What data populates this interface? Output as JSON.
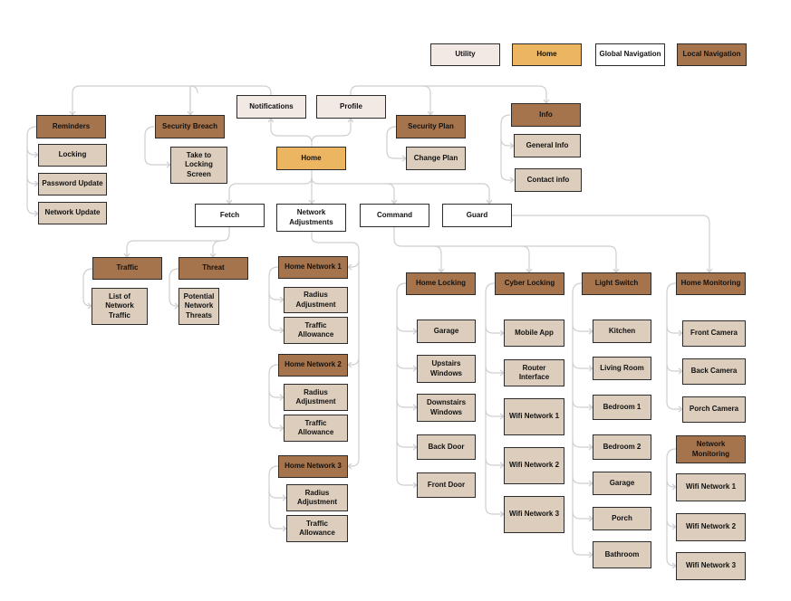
{
  "colors": {
    "utility": "#f2e8e4",
    "home": "#ecb562",
    "global": "#ffffff",
    "local": "#a6744c",
    "sub": "#dccdbc",
    "connector": "#cfcfcf"
  },
  "legend": [
    {
      "label": "Utility",
      "type": "utility"
    },
    {
      "label": "Home",
      "type": "home"
    },
    {
      "label": "Global Navigation",
      "type": "global"
    },
    {
      "label": "Local Navigation",
      "type": "local"
    }
  ],
  "nodes": {
    "notifications": {
      "label": "Notifications",
      "type": "utility"
    },
    "profile": {
      "label": "Profile",
      "type": "utility"
    },
    "home": {
      "label": "Home",
      "type": "home"
    },
    "reminders": {
      "label": "Reminders",
      "type": "local"
    },
    "locking": {
      "label": "Locking",
      "type": "sub"
    },
    "password_update": {
      "label": "Password Update",
      "type": "sub"
    },
    "network_update": {
      "label": "Network Update",
      "type": "sub"
    },
    "security_breach": {
      "label": "Security Breach",
      "type": "local"
    },
    "take_to_locking": {
      "label": "Take to Locking Screen",
      "type": "sub"
    },
    "security_plan": {
      "label": "Security Plan",
      "type": "local"
    },
    "change_plan": {
      "label": "Change Plan",
      "type": "sub"
    },
    "info": {
      "label": "Info",
      "type": "local"
    },
    "general_info": {
      "label": "General Info",
      "type": "sub"
    },
    "contact_info": {
      "label": "Contact info",
      "type": "sub"
    },
    "fetch": {
      "label": "Fetch",
      "type": "global"
    },
    "network_adjustments": {
      "label": "Network Adjustments",
      "type": "global"
    },
    "command": {
      "label": "Command",
      "type": "global"
    },
    "guard": {
      "label": "Guard",
      "type": "global"
    },
    "traffic": {
      "label": "Traffic",
      "type": "local"
    },
    "threat": {
      "label": "Threat",
      "type": "local"
    },
    "list_traffic": {
      "label": "List of Network Traffic",
      "type": "sub"
    },
    "potential_threats": {
      "label": "Potential Network Threats",
      "type": "sub"
    },
    "hn1": {
      "label": "Home Network 1",
      "type": "local"
    },
    "hn1_radius": {
      "label": "Radius Adjustment",
      "type": "sub"
    },
    "hn1_traffic": {
      "label": "Traffic Allowance",
      "type": "sub"
    },
    "hn2": {
      "label": "Home Network 2",
      "type": "local"
    },
    "hn2_radius": {
      "label": "Radius Adjustment",
      "type": "sub"
    },
    "hn2_traffic": {
      "label": "Traffic Allowance",
      "type": "sub"
    },
    "hn3": {
      "label": "Home Network 3",
      "type": "local"
    },
    "hn3_radius": {
      "label": "Radius Adjustment",
      "type": "sub"
    },
    "hn3_traffic": {
      "label": "Traffic Allowance",
      "type": "sub"
    },
    "home_locking": {
      "label": "Home Locking",
      "type": "local"
    },
    "hl_garage": {
      "label": "Garage",
      "type": "sub"
    },
    "hl_upstairs": {
      "label": "Upstairs Windows",
      "type": "sub"
    },
    "hl_downstairs": {
      "label": "Downstairs Windows",
      "type": "sub"
    },
    "hl_back_door": {
      "label": "Back Door",
      "type": "sub"
    },
    "hl_front_door": {
      "label": "Front Door",
      "type": "sub"
    },
    "cyber_locking": {
      "label": "Cyber Locking",
      "type": "local"
    },
    "cl_mobile": {
      "label": "Mobile App",
      "type": "sub"
    },
    "cl_router": {
      "label": "Router Interface",
      "type": "sub"
    },
    "cl_wifi1": {
      "label": "Wifi Network 1",
      "type": "sub"
    },
    "cl_wifi2": {
      "label": "Wifi Network 2",
      "type": "sub"
    },
    "cl_wifi3": {
      "label": "Wifi Network 3",
      "type": "sub"
    },
    "light_switch": {
      "label": "Light Switch",
      "type": "local"
    },
    "ls_kitchen": {
      "label": "Kitchen",
      "type": "sub"
    },
    "ls_living": {
      "label": "Living Room",
      "type": "sub"
    },
    "ls_bed1": {
      "label": "Bedroom 1",
      "type": "sub"
    },
    "ls_bed2": {
      "label": "Bedroom 2",
      "type": "sub"
    },
    "ls_garage": {
      "label": "Garage",
      "type": "sub"
    },
    "ls_porch": {
      "label": "Porch",
      "type": "sub"
    },
    "ls_bathroom": {
      "label": "Bathroom",
      "type": "sub"
    },
    "home_monitoring": {
      "label": "Home Monitoring",
      "type": "local"
    },
    "hm_front": {
      "label": "Front Camera",
      "type": "sub"
    },
    "hm_back": {
      "label": "Back Camera",
      "type": "sub"
    },
    "hm_porch": {
      "label": "Porch Camera",
      "type": "sub"
    },
    "network_monitoring": {
      "label": "Network Monitoring",
      "type": "local"
    },
    "nm_wifi1": {
      "label": "Wifi Network 1",
      "type": "sub"
    },
    "nm_wifi2": {
      "label": "Wifi Network 2",
      "type": "sub"
    },
    "nm_wifi3": {
      "label": "Wifi Network 3",
      "type": "sub"
    }
  }
}
